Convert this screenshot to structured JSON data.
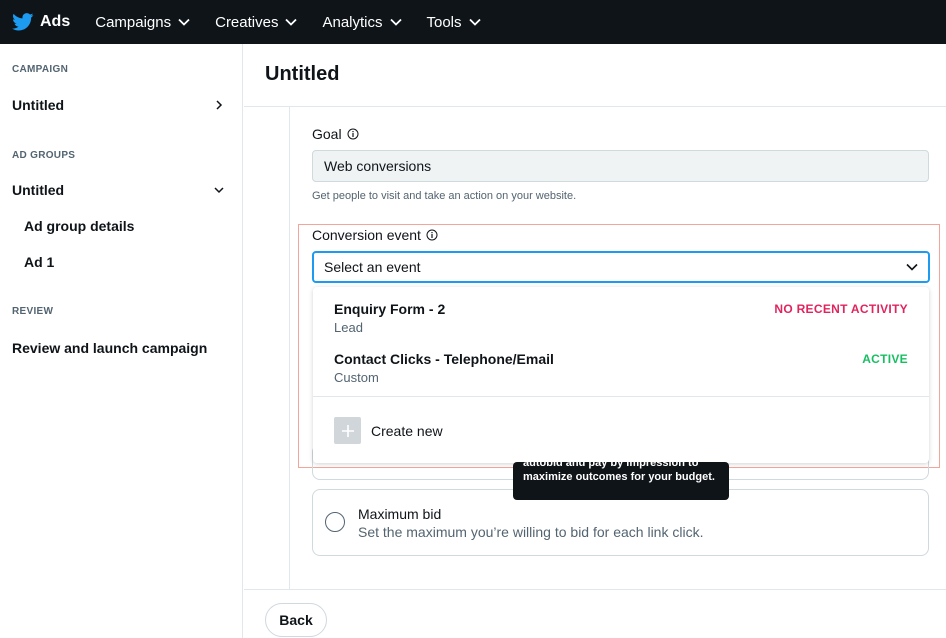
{
  "nav": {
    "brand": "Ads",
    "items": [
      {
        "label": "Campaigns"
      },
      {
        "label": "Creatives"
      },
      {
        "label": "Analytics"
      },
      {
        "label": "Tools"
      }
    ]
  },
  "sidebar": {
    "campaign_label": "CAMPAIGN",
    "campaign_name": "Untitled",
    "ad_groups_label": "AD GROUPS",
    "ad_group_name": "Untitled",
    "ad_group_details": "Ad group details",
    "ad_1": "Ad 1",
    "review_label": "REVIEW",
    "review_item": "Review and launch campaign"
  },
  "main": {
    "title": "Untitled",
    "goal_label": "Goal",
    "goal_value": "Web conversions",
    "goal_helper": "Get people to visit and take an action on your website.",
    "conversion_label": "Conversion event",
    "select_placeholder": "Select an event",
    "options": [
      {
        "name": "Enquiry Form - 2",
        "type": "Lead",
        "status": "NO RECENT ACTIVITY",
        "status_color": "#e0245e"
      },
      {
        "name": "Contact Clicks - Telephone/Email",
        "type": "Custom",
        "status": "ACTIVE",
        "status_color": "#17bf63"
      }
    ],
    "create_new": "Create new",
    "tooltip_line1": "autobid and pay by impression to",
    "tooltip_line2": "maximize outcomes for your budget.",
    "bid_title": "Maximum bid",
    "bid_desc": "Set the maximum you’re willing to bid for each link click.",
    "back": "Back"
  },
  "colors": {
    "nav_bg": "#0f1419",
    "accent": "#1d9bf0",
    "highlight": "#f4a59a"
  }
}
